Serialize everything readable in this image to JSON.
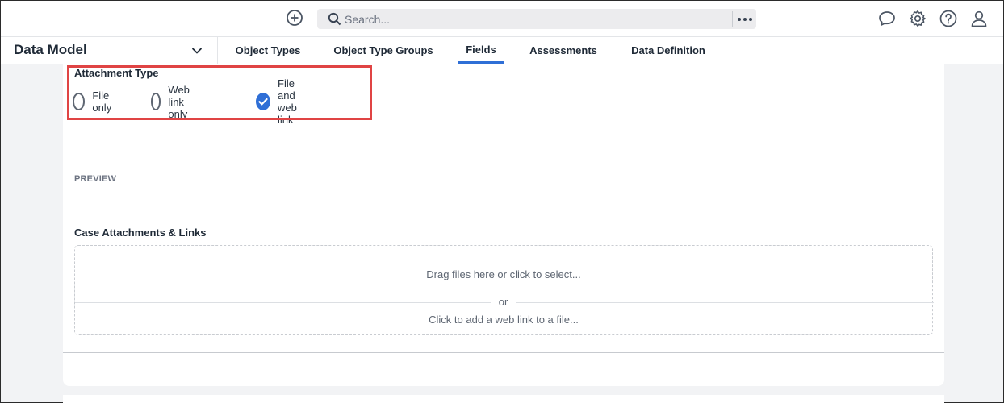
{
  "topbar": {
    "search_placeholder": "Search...",
    "icons": [
      "add-circle-icon",
      "search-icon",
      "more-horizontal-icon",
      "chat-icon",
      "gear-icon",
      "help-icon",
      "user-icon"
    ]
  },
  "nav": {
    "module_title": "Data Model",
    "tabs": [
      {
        "label": "Object Types"
      },
      {
        "label": "Object Type Groups"
      },
      {
        "label": "Fields"
      },
      {
        "label": "Assessments"
      },
      {
        "label": "Data Definition"
      }
    ],
    "active_tab": "Fields"
  },
  "attachment_type": {
    "title": "Attachment Type",
    "options": [
      {
        "label": "File only",
        "checked": false
      },
      {
        "label": "Web link only",
        "checked": false
      },
      {
        "label": "File and web link",
        "checked": true
      }
    ]
  },
  "preview": {
    "label": "PREVIEW",
    "field_title": "Case Attachments & Links",
    "drop_text": "Drag files here or click to select...",
    "or_text": "or",
    "link_text": "Click to add a web link to a file..."
  },
  "colors": {
    "accent": "#2f6fd6",
    "highlight": "#e04444",
    "background": "#f2f3f5"
  }
}
